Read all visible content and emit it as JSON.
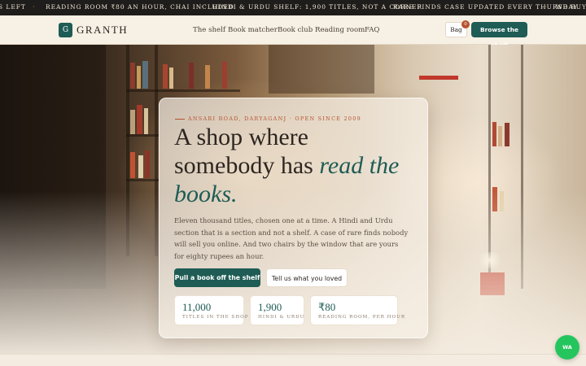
{
  "ticker": {
    "items": [
      "S LEFT",
      "READING ROOM ₹80 AN HOUR, CHAI INCLUDED",
      "HINDI & URDU SHELF: 1,900 TITLES, NOT A CORNER",
      "RARE FINDS CASE UPDATED EVERY THURSDAY",
      "WE BUY B"
    ]
  },
  "header": {
    "logo_mark": "G",
    "logo_text": "GRANTH",
    "nav": [
      "The shelf",
      "Book matcher",
      "Book club",
      "Reading room",
      "FAQ"
    ],
    "bag_label": "Bag",
    "bag_count": "0",
    "browse_label": "Browse the shelf"
  },
  "hero": {
    "eyebrow": "ANSARI ROAD, DARYAGANJ · OPEN SINCE 2009",
    "headline_1": "A shop where",
    "headline_2a": "somebody has ",
    "headline_2b": "read the",
    "headline_3": "books.",
    "description": "Eleven thousand titles, chosen one at a time. A Hindi and Urdu section that is a section and not a shelf. A case of rare finds nobody will sell you online. And two chairs by the window that are yours for eighty rupees an hour.",
    "primary_cta": "Pull a book off the shelf",
    "secondary_cta": "Tell us what you loved",
    "stats": [
      {
        "value": "11,000",
        "label": "TITLES IN THE SHOP"
      },
      {
        "value": "1,900",
        "label": "HINDI & URDU"
      },
      {
        "value": "₹80",
        "label": "READING ROOM, PER HOUR"
      }
    ]
  },
  "whatsapp_label": "WA",
  "colors": {
    "accent": "#1e5c55",
    "rust": "#b5532e",
    "ticker_bg": "#1f1d1b",
    "page_bg": "#f4ece0",
    "whatsapp": "#25c55e"
  }
}
